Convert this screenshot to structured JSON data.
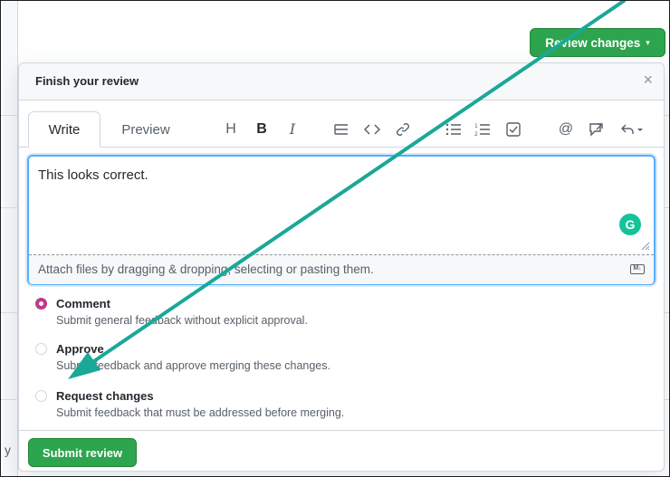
{
  "header": {
    "review_changes_label": "Review changes",
    "caret": "▾"
  },
  "dialog": {
    "title": "Finish your review",
    "close_glyph": "×"
  },
  "editor": {
    "tabs": [
      {
        "label": "Write",
        "active": true
      },
      {
        "label": "Preview",
        "active": false
      }
    ],
    "toolbar": [
      {
        "icon": "heading-icon",
        "glyph": "H"
      },
      {
        "icon": "bold-icon",
        "glyph": "B"
      },
      {
        "icon": "italic-icon",
        "glyph": "I"
      },
      {
        "icon": "quote-icon",
        "glyph": "quote"
      },
      {
        "icon": "code-icon",
        "glyph": "<>"
      },
      {
        "icon": "link-icon",
        "glyph": "link"
      },
      {
        "icon": "unordered-list-icon",
        "glyph": "ul"
      },
      {
        "icon": "ordered-list-icon",
        "glyph": "ol"
      },
      {
        "icon": "task-list-icon",
        "glyph": "task"
      },
      {
        "icon": "mention-icon",
        "glyph": "@"
      },
      {
        "icon": "cross-reference-icon",
        "glyph": "ref"
      },
      {
        "icon": "reply-icon",
        "glyph": "reply"
      }
    ],
    "text_value": "This looks correct.",
    "grammarly_glyph": "G",
    "attach_text": "Attach files by dragging & dropping, selecting or pasting them.",
    "markdown_badge": "M↓"
  },
  "review_options": [
    {
      "title": "Comment",
      "description": "Submit general feedback without explicit approval.",
      "checked": true
    },
    {
      "title": "Approve",
      "description": "Submit feedback and approve merging these changes.",
      "checked": false
    },
    {
      "title": "Request changes",
      "description": "Submit feedback that must be addressed before merging.",
      "checked": false
    }
  ],
  "footer": {
    "submit_label": "Submit review",
    "stray_char": "y"
  },
  "colors": {
    "primary_green": "#2da44e",
    "radio_checked": "#bf3989",
    "focus_blue": "#54aeff",
    "annotation_arrow": "#1aa898"
  }
}
